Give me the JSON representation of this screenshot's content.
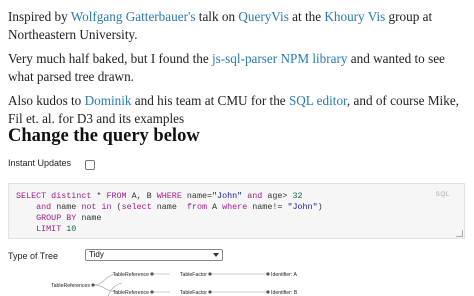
{
  "intro": {
    "p1_inspired": "Inspired by ",
    "p1_author": "Wolfgang Gatterbauer's",
    "p1_talk_on": " talk on ",
    "p1_queryvis": "QueryVis",
    "p1_at_the": " at the ",
    "p1_khoury": "Khoury Vis",
    "p1_group_at": " group at Northeastern University.",
    "p2_start": "Very much half baked, but I found the ",
    "p2_lib": "js-sql-parser NPM library",
    "p2_end": " and wanted to see what parsed tree drawn.",
    "p3_start": "Also kudos to ",
    "p3_dominik": "Dominik",
    "p3_mid": " and his team at CMU for the ",
    "p3_editor": "SQL editor",
    "p3_end": ", and of course Mike, Fil et. al. for D3 and its examples"
  },
  "heading": "Change the query below",
  "instant_updates_label": "Instant Updates",
  "instant_updates_checked": false,
  "editor": {
    "language_label": "SQL",
    "line1": {
      "kw1": "SELECT distinct",
      "t1": " * ",
      "kw2": "FROM",
      "t2": " A, B ",
      "kw3": "WHERE",
      "t3": " name=",
      "s1": "\"John\"",
      "t4": " ",
      "kw4": "and",
      "t5": " age> ",
      "n1": "32"
    },
    "line2": {
      "t0": "    ",
      "kw1": "and",
      "t1": " name ",
      "kw2": "not in",
      "t2": " (",
      "kw3": "select",
      "t3": " name  ",
      "kw4": "from",
      "t4": " A ",
      "kw5": "where",
      "t5": " name!= ",
      "s1": "\"John\"",
      "t6": ")"
    },
    "line3": {
      "t0": "    ",
      "kw1": "GROUP BY",
      "t1": " name"
    },
    "line4": {
      "t0": "    ",
      "kw1": "LIMIT",
      "t1": " ",
      "n1": "10"
    }
  },
  "tree_type_label": "Type of Tree",
  "tree_type_value": "Tidy",
  "tree": {
    "root": "TableReferences",
    "ref1": "TableReference",
    "factor1": "TableFactor",
    "id1": "Identifier: A",
    "ref2": "TableReference",
    "factor2": "TableFactor",
    "id2": "Identifier: B"
  }
}
